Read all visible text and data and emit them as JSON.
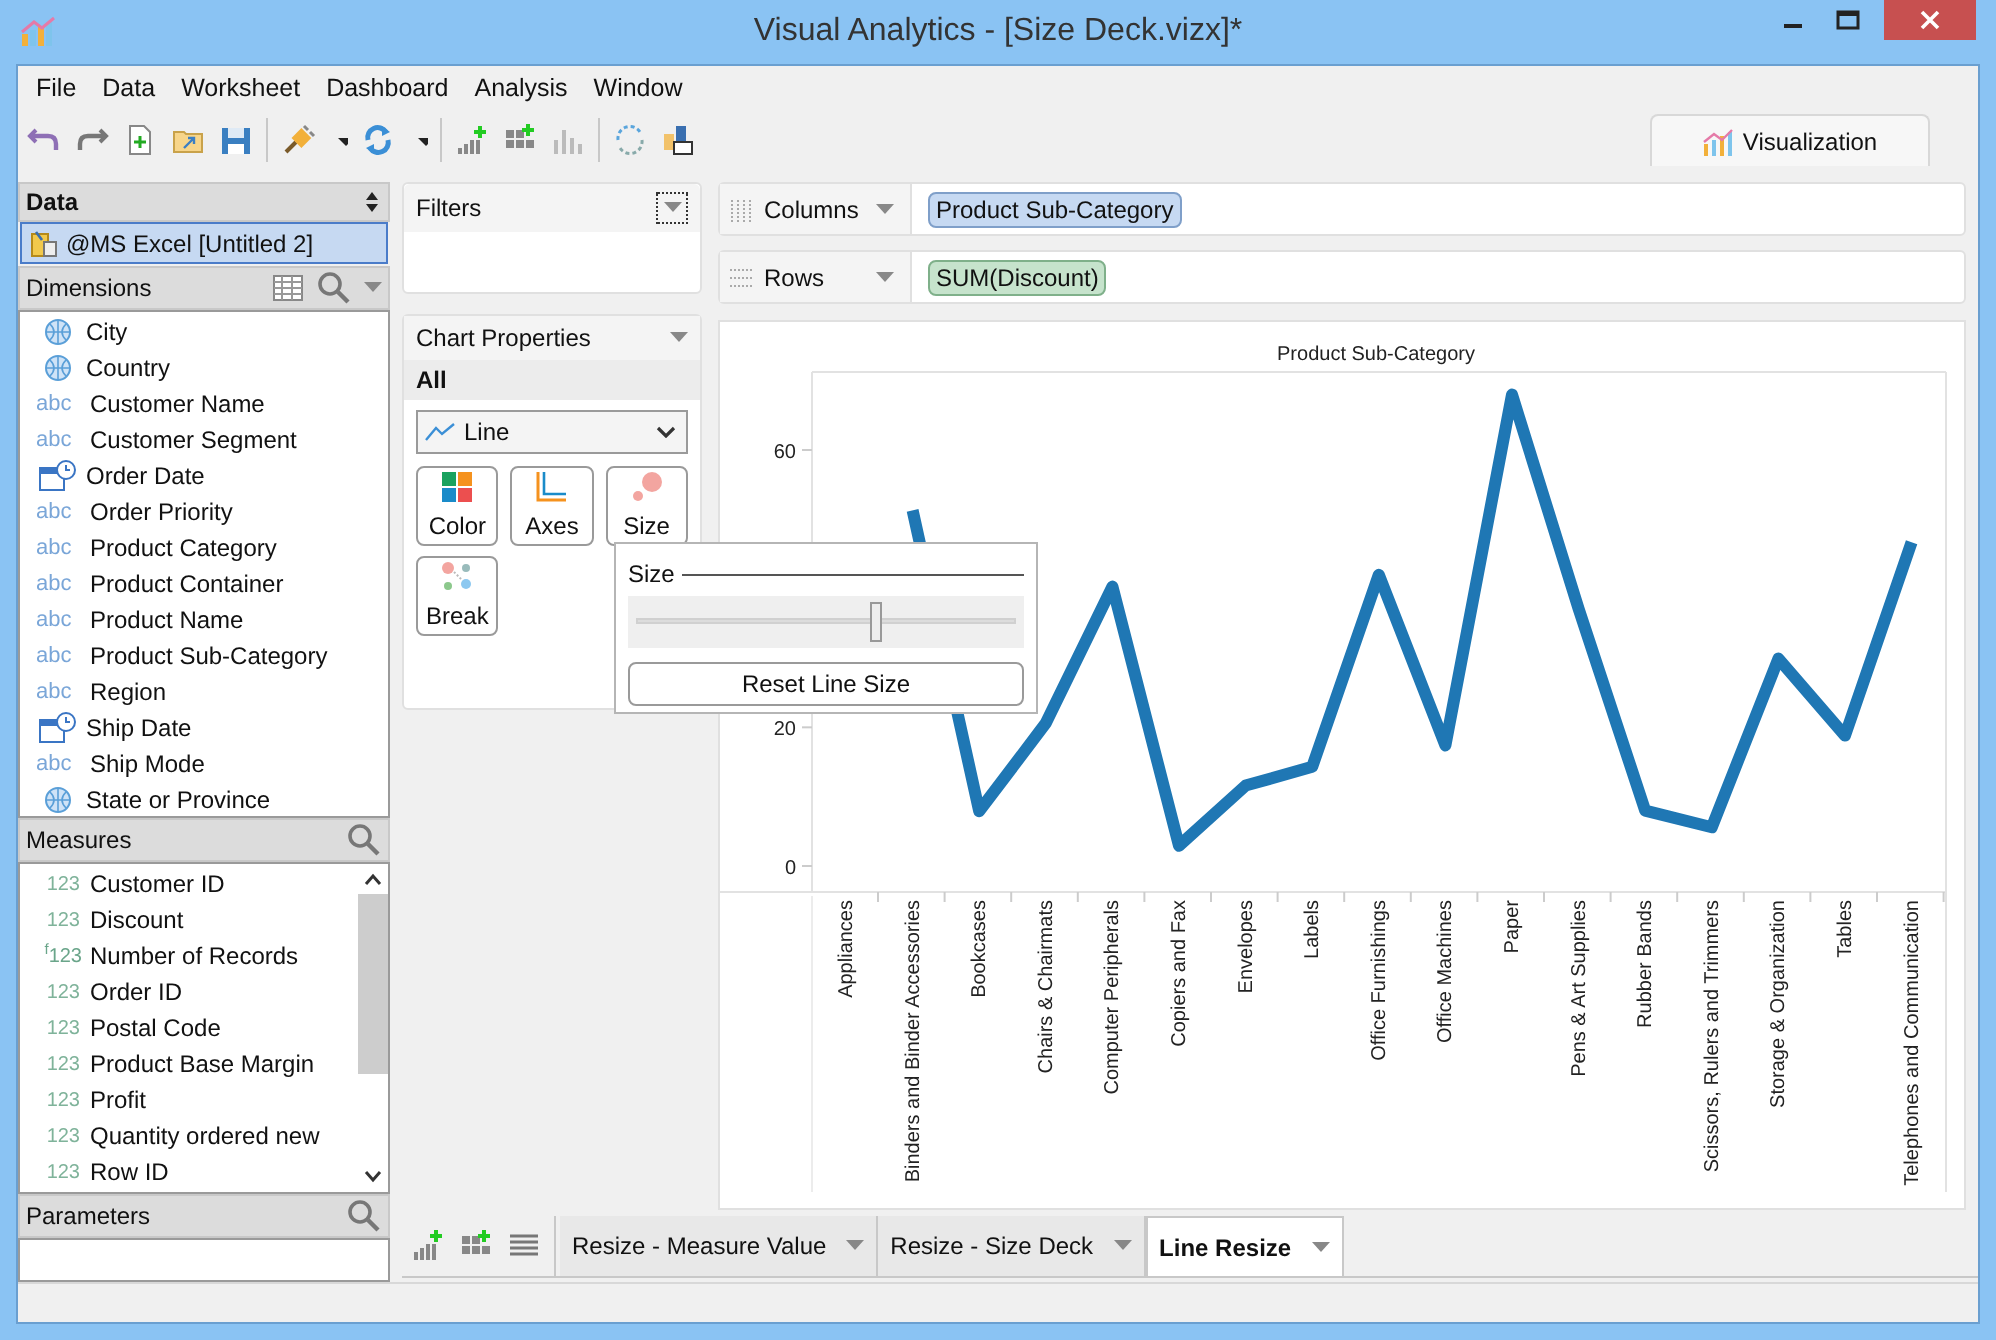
{
  "window": {
    "title": "Visual Analytics - [Size Deck.vizx]*"
  },
  "menu": [
    "File",
    "Data",
    "Worksheet",
    "Dashboard",
    "Analysis",
    "Window"
  ],
  "view_tab": {
    "label": "Visualization"
  },
  "data_panel": {
    "title": "Data",
    "source": {
      "label": "@MS Excel [Untitled 2]",
      "selected": true
    }
  },
  "dimensions": {
    "title": "Dimensions",
    "items": [
      {
        "label": "City",
        "kind": "geo"
      },
      {
        "label": "Country",
        "kind": "geo"
      },
      {
        "label": "Customer Name",
        "kind": "text",
        "badge": "abc"
      },
      {
        "label": "Customer Segment",
        "kind": "text",
        "badge": "abc"
      },
      {
        "label": "Order Date",
        "kind": "date"
      },
      {
        "label": "Order Priority",
        "kind": "text",
        "badge": "abc"
      },
      {
        "label": "Product Category",
        "kind": "text",
        "badge": "abc"
      },
      {
        "label": "Product Container",
        "kind": "text",
        "badge": "abc"
      },
      {
        "label": "Product Name",
        "kind": "text",
        "badge": "abc"
      },
      {
        "label": "Product Sub-Category",
        "kind": "text",
        "badge": "abc"
      },
      {
        "label": "Region",
        "kind": "text",
        "badge": "abc"
      },
      {
        "label": "Ship Date",
        "kind": "date"
      },
      {
        "label": "Ship Mode",
        "kind": "text",
        "badge": "abc"
      },
      {
        "label": "State or Province",
        "kind": "geo"
      }
    ]
  },
  "measures": {
    "title": "Measures",
    "items": [
      {
        "label": "Customer ID",
        "kind": "number",
        "badge": "123"
      },
      {
        "label": "Discount",
        "kind": "number",
        "badge": "123"
      },
      {
        "label": "Number of Records",
        "kind": "calc",
        "badge": "$^{f}$123"
      },
      {
        "label": "Order ID",
        "kind": "number",
        "badge": "123"
      },
      {
        "label": "Postal Code",
        "kind": "number",
        "badge": "123"
      },
      {
        "label": "Product Base Margin",
        "kind": "number",
        "badge": "123"
      },
      {
        "label": "Profit",
        "kind": "number",
        "badge": "123"
      },
      {
        "label": "Quantity ordered new",
        "kind": "number",
        "badge": "123"
      },
      {
        "label": "Row ID",
        "kind": "number",
        "badge": "123"
      }
    ]
  },
  "parameters": {
    "title": "Parameters"
  },
  "filters": {
    "title": "Filters"
  },
  "chart_properties": {
    "title": "Chart Properties",
    "scope": "All",
    "chart_type": "Line",
    "buttons": [
      {
        "label": "Color",
        "kind": "color"
      },
      {
        "label": "Axes",
        "kind": "axes"
      },
      {
        "label": "Size",
        "kind": "size"
      },
      {
        "label": "Break",
        "kind": "break"
      }
    ]
  },
  "size_popup": {
    "title": "Size",
    "level": 0.63,
    "reset": "Reset Line Size"
  },
  "shelves": [
    {
      "label": "Columns",
      "pill": "Product Sub-Category",
      "kind": "dimension"
    },
    {
      "label": "Rows",
      "pill": "SUM(Discount)",
      "kind": "measure"
    }
  ],
  "chart": {
    "chart_data": {
      "type": "line",
      "title": "Product Sub-Category",
      "categories": [
        "Appliances",
        "Binders and Binder Accessories",
        "Bookcases",
        "Chairs & Chairmats",
        "Computer Peripherals",
        "Copiers and Fax",
        "Envelopes",
        "Labels",
        "Office Furnishings",
        "Office Machines",
        "Paper",
        "Pens & Art Supplies",
        "Rubber Bands",
        "Scissors, Rulers and Trimmers",
        "Storage & Organization",
        "Tables",
        "Telephones and Communication"
      ],
      "series": [
        {
          "color": "#1f77b4",
          "values": [
            null,
            51.3,
            7.9,
            20.6,
            40.3,
            2.9,
            11.6,
            14.3,
            42,
            17.4,
            68,
            37.1,
            8,
            5.6,
            29.9,
            18.8,
            46.7
          ]
        }
      ],
      "ylim": [
        -3.75,
        71.25
      ],
      "yticks": [
        0,
        20,
        60
      ]
    }
  },
  "sheet_tabs": [
    {
      "label": "Resize - Measure Value",
      "selected": false
    },
    {
      "label": "Resize - Size Deck",
      "selected": false
    },
    {
      "label": "Line Resize",
      "selected": true
    }
  ]
}
